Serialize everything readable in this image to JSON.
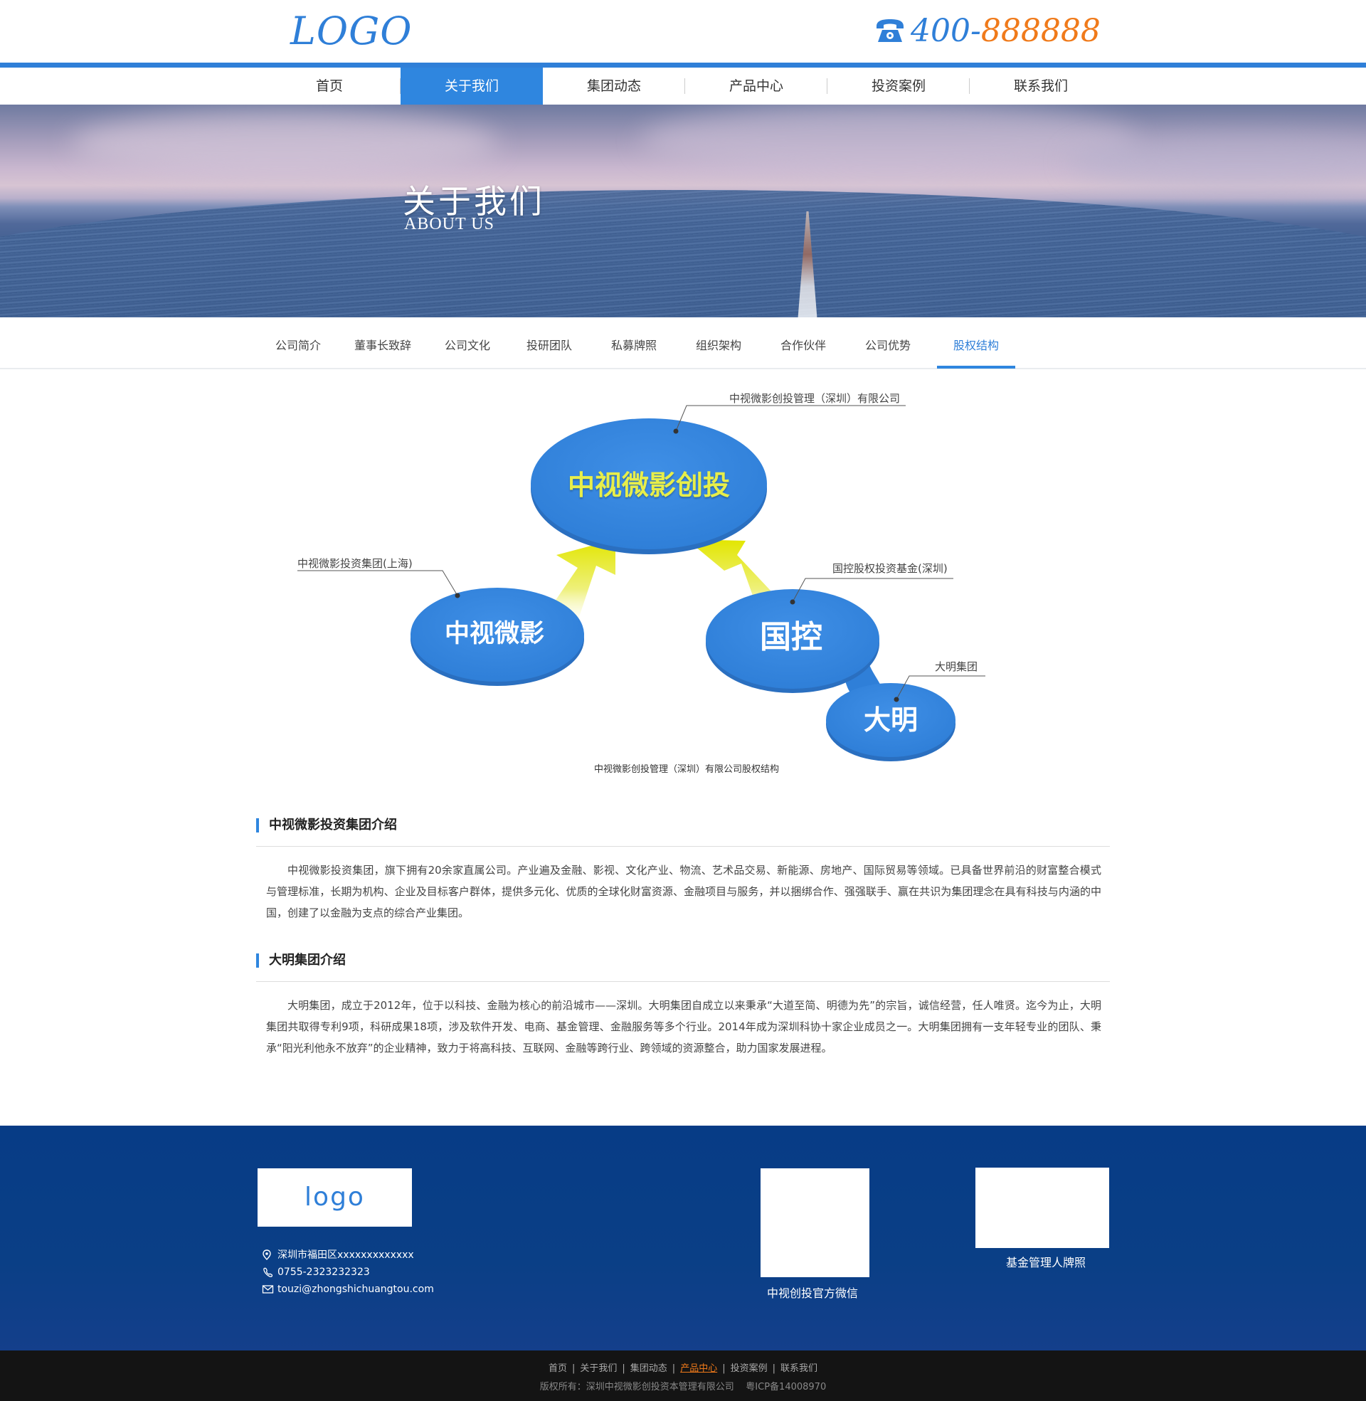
{
  "header": {
    "logo": "LOGO",
    "phone_prefix": "400-",
    "phone_number": "888888",
    "brand_color": "#2f7fd8",
    "accent_color": "#f07a1a"
  },
  "nav": {
    "items": [
      {
        "label": "首页"
      },
      {
        "label": "关于我们",
        "active": true
      },
      {
        "label": "集团动态"
      },
      {
        "label": "产品中心"
      },
      {
        "label": "投资案例"
      },
      {
        "label": "联系我们"
      }
    ]
  },
  "banner": {
    "title": "关于我们",
    "subtitle": "ABOUT US"
  },
  "subnav": {
    "items": [
      {
        "label": "公司简介"
      },
      {
        "label": "董事长致辞"
      },
      {
        "label": "公司文化"
      },
      {
        "label": "投研团队"
      },
      {
        "label": "私募牌照"
      },
      {
        "label": "组织架构"
      },
      {
        "label": "合作伙伴"
      },
      {
        "label": "公司优势"
      },
      {
        "label": "股权结构",
        "active": true
      }
    ]
  },
  "diagram": {
    "nodes": {
      "top": "中视微影创投",
      "left": "中视微影",
      "right": "国控",
      "bottom": "大明"
    },
    "callouts": {
      "top": "中视微影创投管理（深圳）有限公司",
      "left": "中视微影投资集团(上海)",
      "right": "国控股权投资基金(深圳)",
      "bottom": "大明集团"
    },
    "caption": "中视微影创投管理（深圳）有限公司股权结构"
  },
  "sections": [
    {
      "title": "中视微影投资集团介绍",
      "body": "中视微影投资集团，旗下拥有20余家直属公司。产业遍及金融、影视、文化产业、物流、艺术品交易、新能源、房地产、国际贸易等领域。已具备世界前沿的财富整合模式与管理标准，长期为机构、企业及目标客户群体，提供多元化、优质的全球化财富资源、金融项目与服务，并以捆绑合作、强强联手、赢在共识为集团理念在具有科技与内涵的中国，创建了以金融为支点的综合产业集团。"
    },
    {
      "title": "大明集团介绍",
      "body": "大明集团，成立于2012年，位于以科技、金融为核心的前沿城市——深圳。大明集团自成立以来秉承“大道至简、明德为先”的宗旨，诚信经营，任人唯贤。迄今为止，大明集团共取得专利9项，科研成果18项，涉及软件开发、电商、基金管理、金融服务等多个行业。2014年成为深圳科协十家企业成员之一。大明集团拥有一支年轻专业的团队、秉承“阳光利他永不放弃”的企业精神，致力于将高科技、互联网、金融等跨行业、跨领域的资源整合，助力国家发展进程。"
    }
  ],
  "footer": {
    "logo": "logo",
    "address": "深圳市福田区xxxxxxxxxxxxx",
    "phone": "0755-2323232323",
    "email": "touzi@zhongshichuangtou.com",
    "qr1_label": "中视创投官方微信",
    "qr2_label": "基金管理人牌照"
  },
  "bottom": {
    "links": [
      "首页",
      "关于我们",
      "集团动态",
      "产品中心",
      "投资案例",
      "联系我们"
    ],
    "highlighted_link": "产品中心",
    "copyright": "版权所有：深圳中视微影创投资本管理有限公司    粤ICP备14008970"
  }
}
